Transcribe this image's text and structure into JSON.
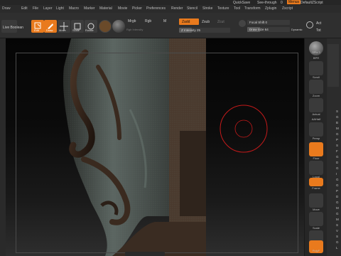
{
  "menu": {
    "top_items": [
      "QuickSave",
      "See-through",
      "0",
      "Menus",
      "DefaultZScript"
    ],
    "items": [
      "Draw",
      "Edit",
      "File",
      "Layer",
      "Light",
      "Macro",
      "Marker",
      "Material",
      "Movie",
      "Picker",
      "Preferences",
      "Render",
      "Stencil",
      "Stroke",
      "Texture",
      "Tool",
      "Transform",
      "Zplugin",
      "Zscript"
    ]
  },
  "toolbar": {
    "lightbox": "Live Boolean",
    "edit": "Edit",
    "draw": "Draw",
    "move": "Move",
    "scale": "Scale",
    "rotate": "Rotate",
    "mrgb": "Mrgb",
    "rgb": "Rgb",
    "m": "M",
    "rgb_intensity": "Rgb Intensity",
    "zadd": "Zadd",
    "zsub": "Zsub",
    "zcut": "Zcut",
    "z_intensity": "Z Intensity 25",
    "focal_shift": "Focal Shift 0",
    "draw_size": "Draw Size 64",
    "dynamic": "Dynamic",
    "a1": "Act",
    "a2": "Tot"
  },
  "shelf": {
    "labels": [
      "BPR",
      "SPix 3",
      "Scroll",
      "Zoom",
      "Actual",
      "AAHalf",
      "Persp",
      "Floor",
      "Local",
      "Frame",
      "Move",
      "Scale",
      "Rotate",
      "PolyF",
      "Transp"
    ],
    "tray_letters": [
      "S",
      "G",
      "B",
      "M",
      "G",
      "P",
      "S",
      "F",
      "G",
      "D",
      "G",
      "I",
      "G",
      "G",
      "P",
      "D",
      "G",
      "M",
      "G",
      "M",
      "S",
      "V",
      "S",
      "G",
      "L"
    ]
  },
  "canvas": {
    "cursor_ring_color": "#c41a1a"
  },
  "colors": {
    "accent": "#e97a1d"
  }
}
